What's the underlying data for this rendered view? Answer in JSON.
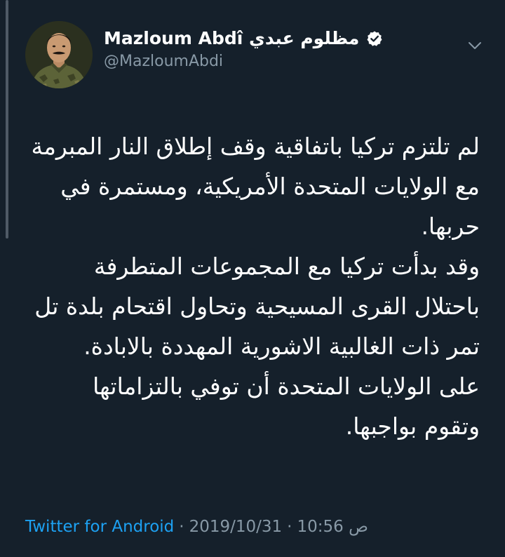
{
  "author": {
    "display_name": "Mazloum Abdî مظلوم عبدي",
    "handle": "@MazloumAbdi",
    "verified": true,
    "avatar_icon": "profile-photo"
  },
  "tweet": {
    "paragraphs": [
      "لم تلتزم تركيا باتفاقية وقف إطلاق النار المبرمة مع الولايات المتحدة الأمريكية، ومستمرة في حربها.",
      "وقد بدأت تركيا مع المجموعات المتطرفة باحتلال القرى المسيحية وتحاول اقتحام بلدة تل تمر ذات الغالبية الاشورية المهددة بالابادة.",
      "على الولايات المتحدة أن توفي بالتزاماتها وتقوم بواجبها."
    ]
  },
  "meta": {
    "time": "10:56 ص",
    "separator": "·",
    "date": "2019/10/31",
    "source": "Twitter for Android"
  },
  "colors": {
    "background": "#15202b",
    "text": "#ffffff",
    "secondary": "#8899a6",
    "link": "#1da1f2"
  },
  "icons": {
    "verified": "verified-badge-icon",
    "menu": "chevron-down-icon"
  }
}
